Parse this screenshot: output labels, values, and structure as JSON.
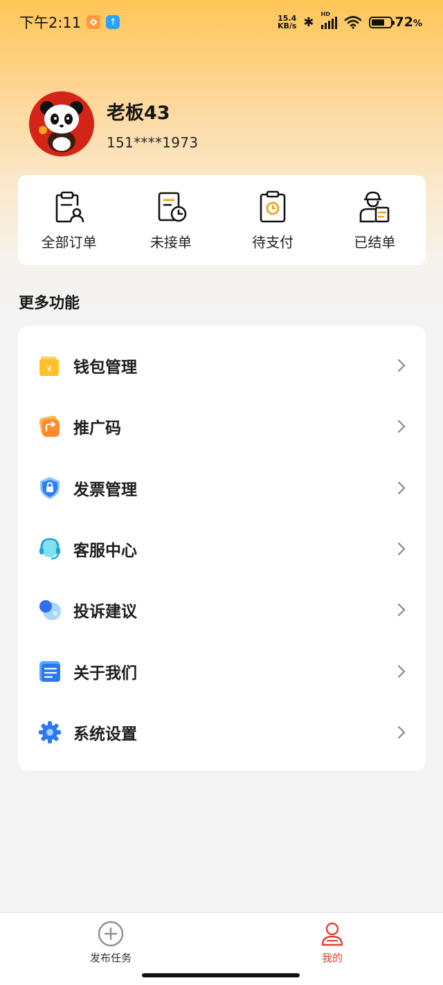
{
  "status_bar": {
    "time": "下午2:11",
    "net_speed_value": "15.4",
    "net_speed_unit": "KB/s",
    "network_type": "HD",
    "battery_percent": "72",
    "battery_unit": "%",
    "battery_level": 0.72
  },
  "profile": {
    "name": "老板43",
    "phone": "151****1973"
  },
  "orders": [
    {
      "label": "全部订单",
      "icon": "clipboard-user-icon"
    },
    {
      "label": "未接单",
      "icon": "document-clock-icon"
    },
    {
      "label": "待支付",
      "icon": "clipboard-clock-icon"
    },
    {
      "label": "已结单",
      "icon": "courier-icon"
    }
  ],
  "more_functions": {
    "title": "更多功能",
    "items": [
      {
        "label": "钱包管理",
        "icon": "wallet-icon"
      },
      {
        "label": "推广码",
        "icon": "share-icon"
      },
      {
        "label": "发票管理",
        "icon": "shield-lock-icon"
      },
      {
        "label": "客服中心",
        "icon": "headset-icon"
      },
      {
        "label": "投诉建议",
        "icon": "chat-bubble-icon"
      },
      {
        "label": "关于我们",
        "icon": "info-doc-icon"
      },
      {
        "label": "系统设置",
        "icon": "gear-icon"
      }
    ]
  },
  "tabs": [
    {
      "label": "发布任务",
      "icon": "plus-circle-icon",
      "active": false
    },
    {
      "label": "我的",
      "icon": "user-icon",
      "active": true
    }
  ],
  "colors": {
    "accent": "#e0412e",
    "header_gradient_top": "#ffc656",
    "background": "#f4f4f5"
  }
}
